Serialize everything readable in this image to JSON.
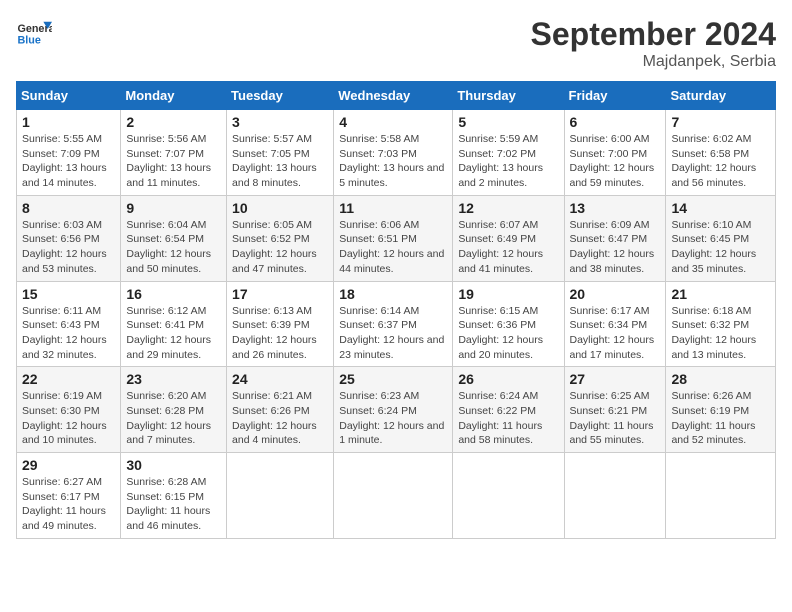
{
  "logo": {
    "line1": "General",
    "line2": "Blue"
  },
  "title": "September 2024",
  "location": "Majdanpek, Serbia",
  "days_of_week": [
    "Sunday",
    "Monday",
    "Tuesday",
    "Wednesday",
    "Thursday",
    "Friday",
    "Saturday"
  ],
  "weeks": [
    [
      {
        "day": 1,
        "text": "Sunrise: 5:55 AM\nSunset: 7:09 PM\nDaylight: 13 hours and 14 minutes."
      },
      {
        "day": 2,
        "text": "Sunrise: 5:56 AM\nSunset: 7:07 PM\nDaylight: 13 hours and 11 minutes."
      },
      {
        "day": 3,
        "text": "Sunrise: 5:57 AM\nSunset: 7:05 PM\nDaylight: 13 hours and 8 minutes."
      },
      {
        "day": 4,
        "text": "Sunrise: 5:58 AM\nSunset: 7:03 PM\nDaylight: 13 hours and 5 minutes."
      },
      {
        "day": 5,
        "text": "Sunrise: 5:59 AM\nSunset: 7:02 PM\nDaylight: 13 hours and 2 minutes."
      },
      {
        "day": 6,
        "text": "Sunrise: 6:00 AM\nSunset: 7:00 PM\nDaylight: 12 hours and 59 minutes."
      },
      {
        "day": 7,
        "text": "Sunrise: 6:02 AM\nSunset: 6:58 PM\nDaylight: 12 hours and 56 minutes."
      }
    ],
    [
      {
        "day": 8,
        "text": "Sunrise: 6:03 AM\nSunset: 6:56 PM\nDaylight: 12 hours and 53 minutes."
      },
      {
        "day": 9,
        "text": "Sunrise: 6:04 AM\nSunset: 6:54 PM\nDaylight: 12 hours and 50 minutes."
      },
      {
        "day": 10,
        "text": "Sunrise: 6:05 AM\nSunset: 6:52 PM\nDaylight: 12 hours and 47 minutes."
      },
      {
        "day": 11,
        "text": "Sunrise: 6:06 AM\nSunset: 6:51 PM\nDaylight: 12 hours and 44 minutes."
      },
      {
        "day": 12,
        "text": "Sunrise: 6:07 AM\nSunset: 6:49 PM\nDaylight: 12 hours and 41 minutes."
      },
      {
        "day": 13,
        "text": "Sunrise: 6:09 AM\nSunset: 6:47 PM\nDaylight: 12 hours and 38 minutes."
      },
      {
        "day": 14,
        "text": "Sunrise: 6:10 AM\nSunset: 6:45 PM\nDaylight: 12 hours and 35 minutes."
      }
    ],
    [
      {
        "day": 15,
        "text": "Sunrise: 6:11 AM\nSunset: 6:43 PM\nDaylight: 12 hours and 32 minutes."
      },
      {
        "day": 16,
        "text": "Sunrise: 6:12 AM\nSunset: 6:41 PM\nDaylight: 12 hours and 29 minutes."
      },
      {
        "day": 17,
        "text": "Sunrise: 6:13 AM\nSunset: 6:39 PM\nDaylight: 12 hours and 26 minutes."
      },
      {
        "day": 18,
        "text": "Sunrise: 6:14 AM\nSunset: 6:37 PM\nDaylight: 12 hours and 23 minutes."
      },
      {
        "day": 19,
        "text": "Sunrise: 6:15 AM\nSunset: 6:36 PM\nDaylight: 12 hours and 20 minutes."
      },
      {
        "day": 20,
        "text": "Sunrise: 6:17 AM\nSunset: 6:34 PM\nDaylight: 12 hours and 17 minutes."
      },
      {
        "day": 21,
        "text": "Sunrise: 6:18 AM\nSunset: 6:32 PM\nDaylight: 12 hours and 13 minutes."
      }
    ],
    [
      {
        "day": 22,
        "text": "Sunrise: 6:19 AM\nSunset: 6:30 PM\nDaylight: 12 hours and 10 minutes."
      },
      {
        "day": 23,
        "text": "Sunrise: 6:20 AM\nSunset: 6:28 PM\nDaylight: 12 hours and 7 minutes."
      },
      {
        "day": 24,
        "text": "Sunrise: 6:21 AM\nSunset: 6:26 PM\nDaylight: 12 hours and 4 minutes."
      },
      {
        "day": 25,
        "text": "Sunrise: 6:23 AM\nSunset: 6:24 PM\nDaylight: 12 hours and 1 minute."
      },
      {
        "day": 26,
        "text": "Sunrise: 6:24 AM\nSunset: 6:22 PM\nDaylight: 11 hours and 58 minutes."
      },
      {
        "day": 27,
        "text": "Sunrise: 6:25 AM\nSunset: 6:21 PM\nDaylight: 11 hours and 55 minutes."
      },
      {
        "day": 28,
        "text": "Sunrise: 6:26 AM\nSunset: 6:19 PM\nDaylight: 11 hours and 52 minutes."
      }
    ],
    [
      {
        "day": 29,
        "text": "Sunrise: 6:27 AM\nSunset: 6:17 PM\nDaylight: 11 hours and 49 minutes."
      },
      {
        "day": 30,
        "text": "Sunrise: 6:28 AM\nSunset: 6:15 PM\nDaylight: 11 hours and 46 minutes."
      },
      {
        "day": null,
        "text": ""
      },
      {
        "day": null,
        "text": ""
      },
      {
        "day": null,
        "text": ""
      },
      {
        "day": null,
        "text": ""
      },
      {
        "day": null,
        "text": ""
      }
    ]
  ]
}
